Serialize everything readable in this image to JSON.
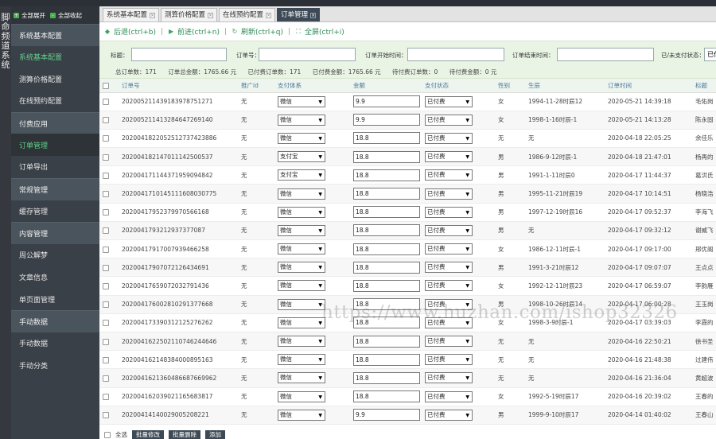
{
  "left_strip": {
    "chars": [
      "脚",
      "命",
      "频",
      "道",
      "系",
      "统"
    ]
  },
  "sidebar": {
    "expand_all": "全部展开",
    "collapse_all": "全部收起",
    "items": [
      {
        "label": "系统基本配置",
        "kind": "group"
      },
      {
        "label": "系统基本配置",
        "kind": "active"
      },
      {
        "label": "测算价格配置",
        "kind": "item"
      },
      {
        "label": "在线预约配置",
        "kind": "item"
      },
      {
        "label": "付费应用",
        "kind": "group"
      },
      {
        "label": "订单管理",
        "kind": "activesub"
      },
      {
        "label": "订单导出",
        "kind": "item"
      },
      {
        "label": "常规管理",
        "kind": "group"
      },
      {
        "label": "缓存管理",
        "kind": "item"
      },
      {
        "label": "内容管理",
        "kind": "group"
      },
      {
        "label": "周公解梦",
        "kind": "item"
      },
      {
        "label": "文章信息",
        "kind": "item"
      },
      {
        "label": "单页面管理",
        "kind": "item"
      },
      {
        "label": "手动数据",
        "kind": "group"
      },
      {
        "label": "手动数据",
        "kind": "item"
      },
      {
        "label": "手动分类",
        "kind": "item"
      }
    ]
  },
  "tabs": [
    {
      "label": "系统基本配置",
      "active": false
    },
    {
      "label": "测算价格配置",
      "active": false
    },
    {
      "label": "在线预约配置",
      "active": false
    },
    {
      "label": "订单管理",
      "active": true
    }
  ],
  "nav": {
    "back": "后退(ctrl+b)",
    "forward": "前进(ctrl+n)",
    "refresh": "刷新(ctrl+q)",
    "fullscreen": "全屏(ctrl+i)"
  },
  "filter": {
    "title_label": "标题：",
    "order_label": "订单号：",
    "start_label": "订单开始时间：",
    "end_label": "订单结束时间：",
    "pay_label": "已/未支付状态：",
    "pay_value": "已付"
  },
  "stats": {
    "total_orders": "总订单数：171",
    "total_amount": "订单总金额：1765.66 元",
    "paid_orders": "已付费订单数：171",
    "paid_amount": "已付费金额：1765.66 元",
    "unpaid_orders": "待付费订单数：0",
    "unpaid_amount": "待付费金额：0 元"
  },
  "table": {
    "headers": [
      "订单号",
      "推广id",
      "支付体系",
      "金额",
      "支付状态",
      "性别",
      "生辰",
      "订单时间",
      "标题"
    ],
    "rows": [
      {
        "order": "20200521143918397875127​1",
        "uid": "无",
        "pay": "微信",
        "amount": "9.9",
        "status": "已付费",
        "sex": "女",
        "birth": "1994-11-28时辰12",
        "time": "2020-05-21 14:39:18",
        "title": "毛佑岗"
      },
      {
        "order": "202005211413284647269140",
        "uid": "无",
        "pay": "微信",
        "amount": "9.9",
        "status": "已付费",
        "sex": "女",
        "birth": "1998-1-16时辰-1",
        "time": "2020-05-21 14:13:28",
        "title": "陈永固"
      },
      {
        "order": "202004182205251273742388​6",
        "uid": "无",
        "pay": "微信",
        "amount": "18.8",
        "status": "已付费",
        "sex": "无",
        "birth": "无",
        "time": "2020-04-18 22:05:25",
        "title": "余佳乐"
      },
      {
        "order": "202004182147011142500537",
        "uid": "无",
        "pay": "支付宝",
        "amount": "18.8",
        "status": "已付费",
        "sex": "男",
        "birth": "1986-9-12时辰-1",
        "time": "2020-04-18 21:47:01",
        "title": "杨再的"
      },
      {
        "order": "202004171144371959094842",
        "uid": "无",
        "pay": "支付宝",
        "amount": "18.8",
        "status": "已付费",
        "sex": "男",
        "birth": "1991-1-11时辰0",
        "time": "2020-04-17 11:44:37",
        "title": "葛洪氏"
      },
      {
        "order": "202004171014511160803077​5",
        "uid": "无",
        "pay": "微信",
        "amount": "18.8",
        "status": "已付费",
        "sex": "男",
        "birth": "1995-11-21时辰19",
        "time": "2020-04-17 10:14:51",
        "title": "杨晓浩"
      },
      {
        "order": "202004179523799705661​68",
        "uid": "无",
        "pay": "微信",
        "amount": "18.8",
        "status": "已付费",
        "sex": "男",
        "birth": "1997-12-19时辰16",
        "time": "2020-04-17 09:52:37",
        "title": "李海飞"
      },
      {
        "order": "202004179321293737708​7",
        "uid": "无",
        "pay": "微信",
        "amount": "18.8",
        "status": "已付费",
        "sex": "男",
        "birth": "无",
        "time": "2020-04-17 09:32:12",
        "title": "谢威飞"
      },
      {
        "order": "20200417917007939466258",
        "uid": "无",
        "pay": "微信",
        "amount": "18.8",
        "status": "已付费",
        "sex": "女",
        "birth": "1986-12-11时辰-1",
        "time": "2020-04-17 09:17:00",
        "title": "邢优阁"
      },
      {
        "order": "20200417907072126434691",
        "uid": "无",
        "pay": "微信",
        "amount": "18.8",
        "status": "已付费",
        "sex": "男",
        "birth": "1991-3-21时辰12",
        "time": "2020-04-17 09:07:07",
        "title": "王点点"
      },
      {
        "order": "20200417659072032791436",
        "uid": "无",
        "pay": "微信",
        "amount": "18.8",
        "status": "已付费",
        "sex": "女",
        "birth": "1992-12-11时辰23",
        "time": "2020-04-17 06:59:07",
        "title": "李韵雁"
      },
      {
        "order": "202004176002810291377668",
        "uid": "无",
        "pay": "微信",
        "amount": "18.8",
        "status": "已付费",
        "sex": "男",
        "birth": "1998-10-26时辰14",
        "time": "2020-04-17 06:00:28",
        "title": "王玉岗"
      },
      {
        "order": "20200417339031212527626​2",
        "uid": "无",
        "pay": "微信",
        "amount": "18.8",
        "status": "已付费",
        "sex": "女",
        "birth": "1998-3-9时辰-1",
        "time": "2020-04-17 03:39:03",
        "title": "李霞的"
      },
      {
        "order": "20200416225021107462446​46",
        "uid": "无",
        "pay": "微信",
        "amount": "18.8",
        "status": "已付费",
        "sex": "无",
        "birth": "无",
        "time": "2020-04-16 22:50:21",
        "title": "徐书圣"
      },
      {
        "order": "20200416214838400089516​3",
        "uid": "无",
        "pay": "微信",
        "amount": "18.8",
        "status": "已付费",
        "sex": "无",
        "birth": "无",
        "time": "2020-04-16 21:48:38",
        "title": "过建伟"
      },
      {
        "order": "20200416213604866876699​62",
        "uid": "无",
        "pay": "微信",
        "amount": "18.8",
        "status": "已付费",
        "sex": "无",
        "birth": "无",
        "time": "2020-04-16 21:36:04",
        "title": "黄超波"
      },
      {
        "order": "20200416203902116568381​7",
        "uid": "无",
        "pay": "微信",
        "amount": "18.8",
        "status": "已付费",
        "sex": "女",
        "birth": "1992-5-19时辰17",
        "time": "2020-04-16 20:39:02",
        "title": "王春的"
      },
      {
        "order": "202004141400290052082​21",
        "uid": "无",
        "pay": "微信",
        "amount": "9.9",
        "status": "已付费",
        "sex": "男",
        "birth": "1999-9-10时辰17",
        "time": "2020-04-14 01:40:02",
        "title": "王春山"
      }
    ]
  },
  "footer": {
    "select_all": "全选",
    "batch_edit": "批量修改",
    "batch_delete": "批量删除",
    "add": "添加"
  },
  "watermark": "https://www.huzhan.com/ishop32326"
}
